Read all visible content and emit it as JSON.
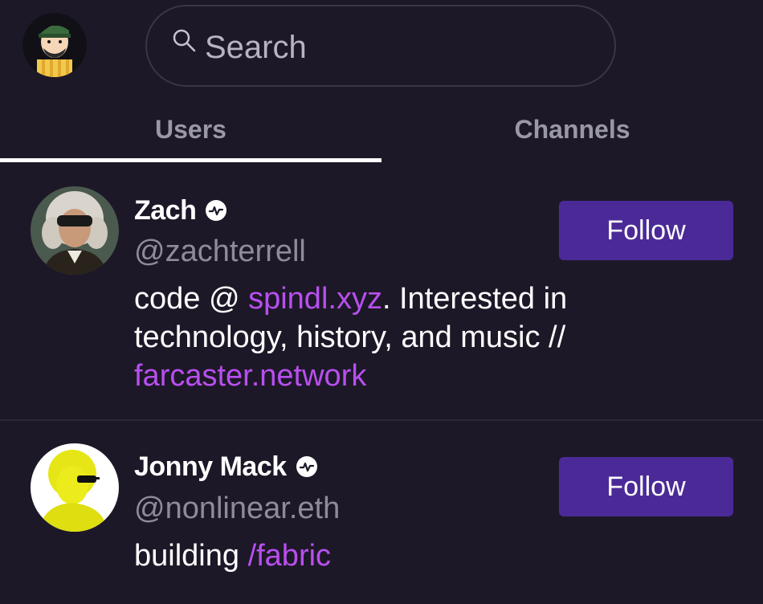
{
  "header": {
    "search": {
      "placeholder": "Search",
      "value": ""
    }
  },
  "tabs": [
    {
      "label": "Users",
      "active": true
    },
    {
      "label": "Channels",
      "active": false
    }
  ],
  "users": [
    {
      "name": "Zach",
      "handle": "@zachterrell",
      "bio": {
        "part1": "code @ ",
        "link1": "spindl.xyz",
        "part2": ". Interested in technology, history, and music // ",
        "link2": "farcaster.network"
      },
      "follow_label": "Follow"
    },
    {
      "name": "Jonny Mack",
      "handle": "@nonlinear.eth",
      "bio": {
        "part1": "building ",
        "link1": "/fabric"
      },
      "follow_label": "Follow"
    }
  ],
  "colors": {
    "background": "#1d1827",
    "accent_button": "#4b2a98",
    "link": "#b84ff0",
    "muted_text": "#8f8b99"
  },
  "icons": {
    "search": "search-icon",
    "verified": "verified-badge-icon"
  }
}
